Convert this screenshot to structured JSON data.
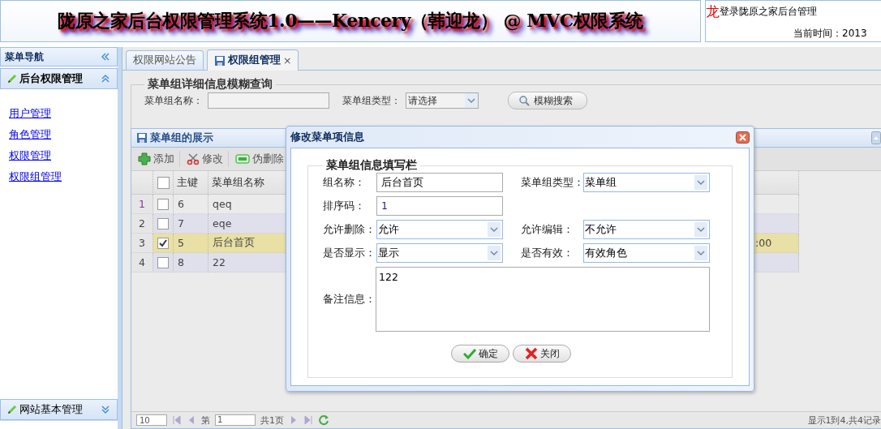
{
  "header": {
    "title": "陇原之家后台权限管理系统1.0——Kencery（韩迎龙） @ MVC权限系统",
    "marquee": "龙",
    "login_text": "登录陇原之家后台管理",
    "time_label": "当前时间：2013"
  },
  "sidebar": {
    "title": "菜单导航",
    "sections": [
      {
        "label": "后台权限管理",
        "expanded": true,
        "items": [
          "用户管理",
          "角色管理",
          "权限管理",
          "权限组管理"
        ]
      },
      {
        "label": "网站基本管理",
        "expanded": false
      }
    ]
  },
  "tabs": [
    {
      "label": "权限网站公告",
      "selected": false,
      "closable": false
    },
    {
      "label": "权限组管理",
      "selected": true,
      "closable": true,
      "close": "×"
    }
  ],
  "search": {
    "legend": "菜单组详细信息模糊查询",
    "fields": [
      {
        "kind": "text",
        "label": "菜单组名称："
      },
      {
        "kind": "select",
        "label": "菜单组类型：",
        "value": "请选择"
      }
    ],
    "button": "模糊搜索"
  },
  "grid": {
    "title": "菜单组的展示",
    "toolbar": [
      {
        "kind": "add",
        "label": "添加"
      },
      {
        "kind": "edit",
        "label": "修改"
      },
      {
        "kind": "remove",
        "label": "伪删除"
      }
    ],
    "all_checked": false,
    "columns": [
      "主键",
      "菜单组名称"
    ],
    "rows": [
      {
        "num": "1",
        "id": "6",
        "name": "qeq",
        "checked": false,
        "selected": false
      },
      {
        "num": "2",
        "id": "7",
        "name": "eqe",
        "checked": false,
        "selected": false
      },
      {
        "num": "3",
        "id": "5",
        "name": "后台首页",
        "checked": true,
        "selected": true,
        "column_5": ":00"
      },
      {
        "num": "4",
        "id": "8",
        "name": "22",
        "checked": false,
        "selected": false
      }
    ],
    "pager": {
      "page_size": "10",
      "page_label": "第",
      "page": "1",
      "total_pages": "共1页",
      "summary": "显示1到4,共4记录"
    }
  },
  "dialog": {
    "title": "修改菜单项信息",
    "legend": "菜单组信息填写栏",
    "fields": [
      {
        "kind": "text",
        "label": "组名称：",
        "value": "后台首页"
      },
      {
        "kind": "select",
        "label": "菜单组类型：",
        "value": "菜单组"
      },
      {
        "kind": "text",
        "label": "排序码：",
        "value": "1"
      },
      {
        "kind": "blank"
      },
      {
        "kind": "select",
        "label": "允许删除：",
        "value": "允许"
      },
      {
        "kind": "select",
        "label": "允许编辑：",
        "value": "不允许"
      },
      {
        "kind": "select",
        "label": "是否显示：",
        "value": "显示"
      },
      {
        "kind": "select",
        "label": "是否有效：",
        "value": "有效角色"
      }
    ],
    "remark": {
      "label": "备注信息：",
      "value": "122"
    },
    "buttons": [
      {
        "kind": "ok",
        "label": "确定"
      },
      {
        "kind": "close",
        "label": "关闭"
      }
    ]
  }
}
